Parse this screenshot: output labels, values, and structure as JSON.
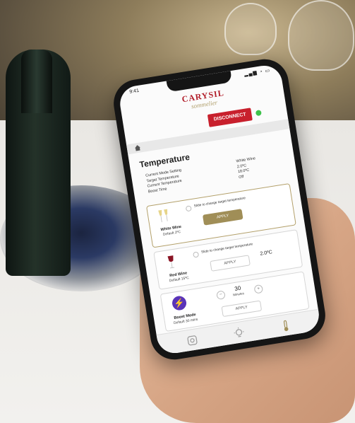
{
  "status": {
    "time": "9:41",
    "icons": "▂▄▆ ◔ ▭"
  },
  "brand": {
    "name": "CARYSIL",
    "sub": "sommelier"
  },
  "header": {
    "disconnect_label": "DISCONNECT",
    "connected_color": "#3ec24b"
  },
  "page": {
    "title": "Temperature"
  },
  "info": {
    "rows": [
      {
        "label": "Current Mode Setting",
        "value": "White Wine"
      },
      {
        "label": "Target Temperature",
        "value": "2.0ºC"
      },
      {
        "label": "Current Temperature",
        "value": "18.0ºC"
      },
      {
        "label": "Boost Time",
        "value": "Off"
      }
    ]
  },
  "white_wine": {
    "name": "White Wine",
    "default": "Default 2ºC",
    "hint": "Slide to change target temperature",
    "apply": "APPLY"
  },
  "red_wine": {
    "name": "Red Wine",
    "default": "Default 15ºC",
    "hint": "Slide to change target temperature",
    "apply": "APPLY",
    "temp": "2.0ºC"
  },
  "boost": {
    "name": "Boost Mode",
    "default": "Default 30 mins",
    "minutes": "30",
    "unit": "Minutes",
    "apply": "APPLY",
    "minus": "−",
    "plus": "+"
  },
  "colors": {
    "accent": "#a08e57",
    "brand_red": "#c8202d",
    "boost": "#5a34b8"
  }
}
